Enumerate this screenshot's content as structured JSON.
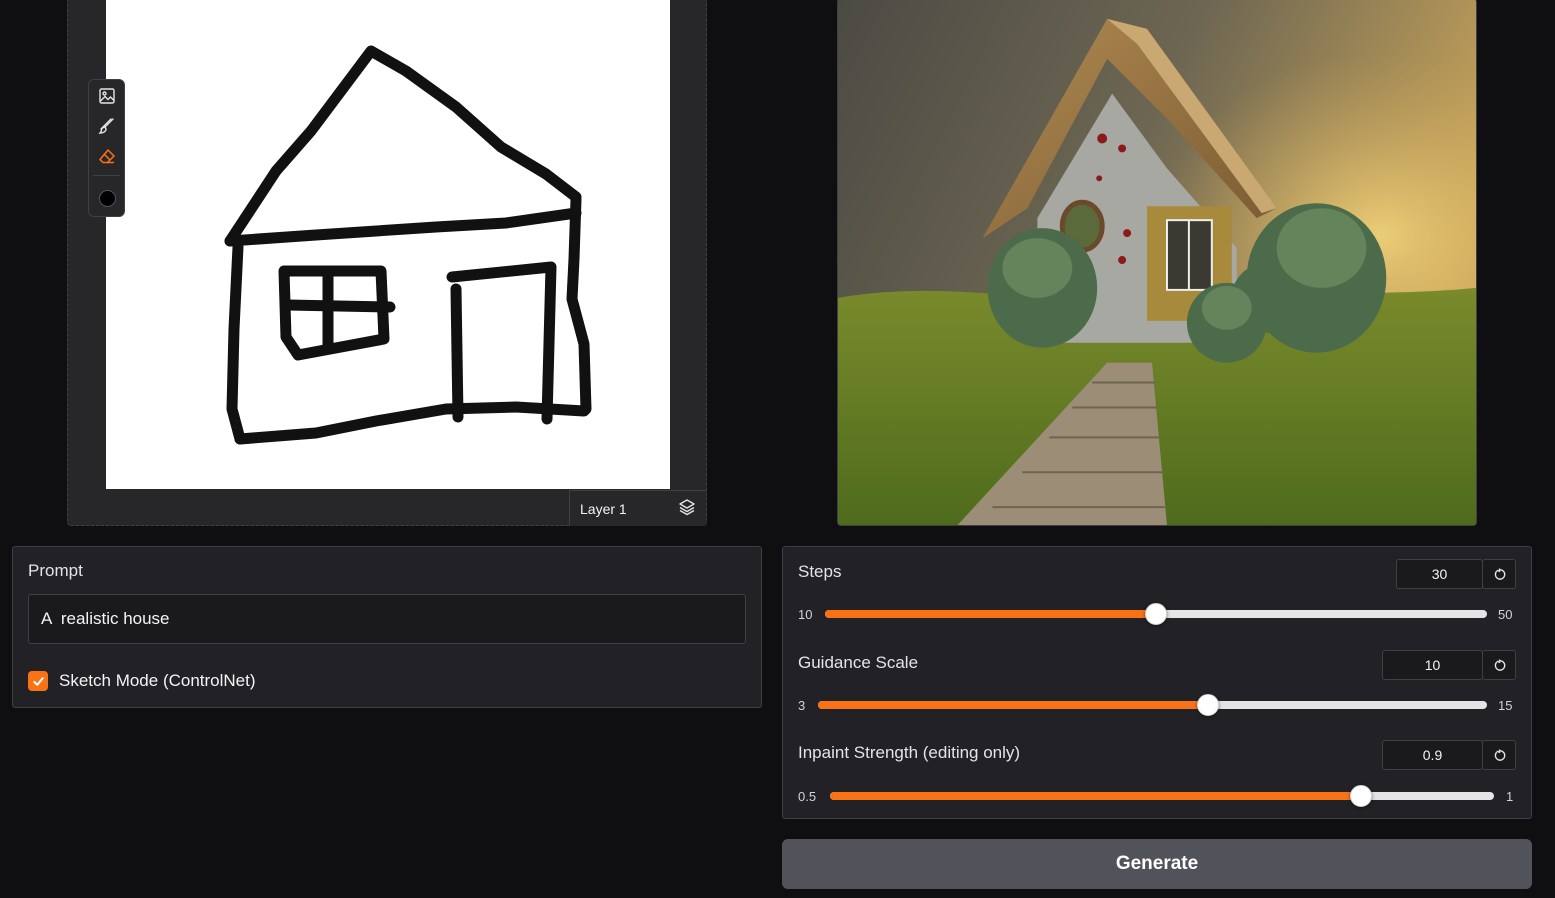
{
  "sketch": {
    "layer_label": "Layer 1",
    "brush_color": "#000000",
    "tools": [
      "image-icon",
      "brush-icon",
      "eraser-icon"
    ],
    "active_tool": "eraser-icon"
  },
  "prompt": {
    "label": "Prompt",
    "value": "A  realistic house"
  },
  "sketch_mode": {
    "label": "Sketch Mode (ControlNet)",
    "checked": true
  },
  "sliders": [
    {
      "label": "Steps",
      "value": "30",
      "min": "10",
      "max": "50",
      "fraction": 0.5
    },
    {
      "label": "Guidance Scale",
      "value": "10",
      "min": "3",
      "max": "15",
      "fraction": 0.583
    },
    {
      "label": "Inpaint Strength (editing only)",
      "value": "0.9",
      "min": "0.5",
      "max": "1",
      "fraction": 0.8
    }
  ],
  "generate": {
    "label": "Generate"
  },
  "colors": {
    "accent": "#f97316",
    "panel": "#222226",
    "background": "#0f0f11"
  }
}
